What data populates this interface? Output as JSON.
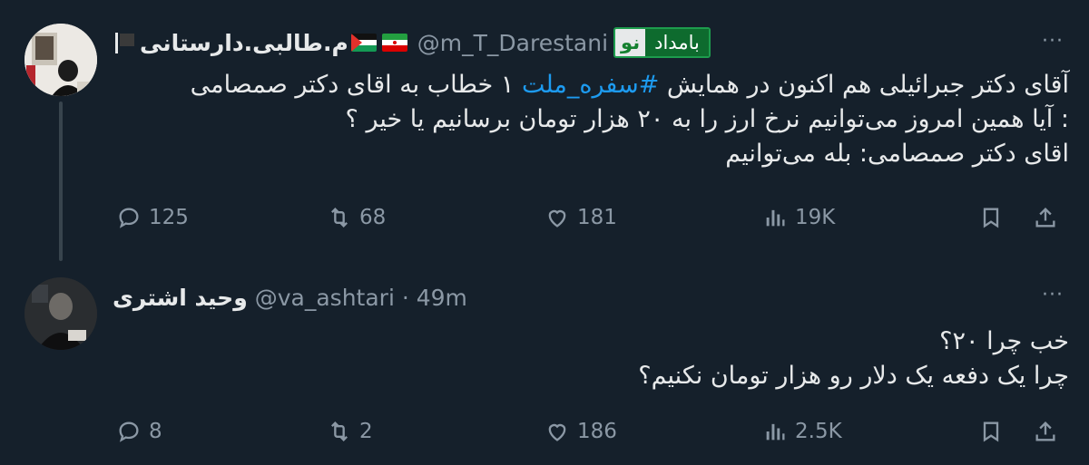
{
  "tweets": [
    {
      "name": "م.طالبی.دارستانی",
      "handle": "@m_T_Darestani",
      "badge_left": "نو",
      "badge_right": "بامداد",
      "body_line1_pre": "آقای دکتر جبرائیلی هم اکنون در همایش ",
      "body_hashtag": "#سفره_ملت",
      "body_line1_post": " ۱ خطاب به اقای دکتر صمصامی",
      "body_line2": ": آیا همین امروز می‌توانیم نرخ ارز را به ۲۰ هزار تومان برسانیم یا خیر ؟",
      "body_line3": "اقای دکتر صمصامی: بله می‌توانیم",
      "replies": "125",
      "retweets": "68",
      "likes": "181",
      "views": "19K"
    },
    {
      "name": "وحید اشتری",
      "handle": "@va_ashtari · 49m",
      "body_line1": "خب چرا ۲۰؟",
      "body_line2": "چرا یک دفعه یک دلار رو هزار تومان نکنیم؟",
      "replies": "8",
      "retweets": "2",
      "likes": "186",
      "views": "2.5K"
    }
  ],
  "more_label": "···",
  "icons": [
    "reply-icon",
    "retweet-icon",
    "like-icon",
    "views-icon",
    "bookmark-icon",
    "share-icon",
    "more-icon",
    "flag-icon"
  ],
  "colors": {
    "background": "#15202b",
    "text": "#e7e9ea",
    "muted": "#8b98a5",
    "link": "#1d9bf0",
    "badge_green": "#0e6b2e"
  }
}
